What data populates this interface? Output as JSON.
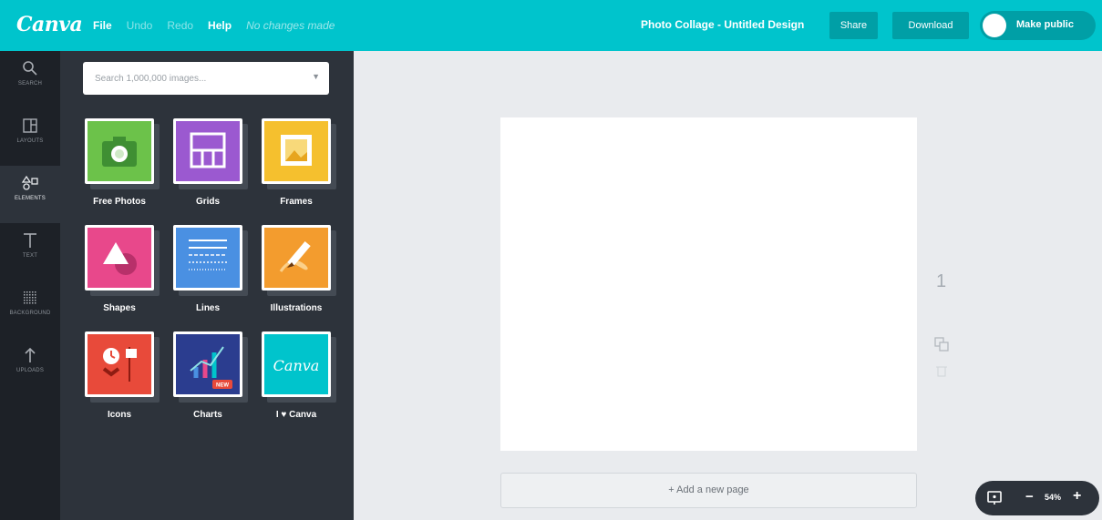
{
  "app": {
    "logo": "Canva"
  },
  "menu": {
    "file": "File",
    "undo": "Undo",
    "redo": "Redo",
    "help": "Help",
    "status": "No changes made"
  },
  "header": {
    "design_title": "Photo Collage - Untitled Design",
    "share": "Share",
    "download": "Download",
    "make_public": "Make public"
  },
  "rail": {
    "items": [
      {
        "label": "SEARCH",
        "icon": "search-icon"
      },
      {
        "label": "LAYOUTS",
        "icon": "layouts-icon"
      },
      {
        "label": "ELEMENTS",
        "icon": "elements-icon",
        "active": true
      },
      {
        "label": "TEXT",
        "icon": "text-icon"
      },
      {
        "label": "BACKGROUND",
        "icon": "background-icon"
      },
      {
        "label": "UPLOADS",
        "icon": "upload-icon"
      }
    ]
  },
  "search": {
    "placeholder": "Search 1,000,000 images..."
  },
  "elements": {
    "tiles": [
      {
        "label": "Free Photos",
        "color": "#6cc24a",
        "icon": "camera-icon"
      },
      {
        "label": "Grids",
        "color": "#9b59d0",
        "icon": "grid-icon"
      },
      {
        "label": "Frames",
        "color": "#f5c02e",
        "icon": "frame-icon"
      },
      {
        "label": "Shapes",
        "color": "#e8488b",
        "icon": "shapes-icon"
      },
      {
        "label": "Lines",
        "color": "#4a90e2",
        "icon": "lines-icon"
      },
      {
        "label": "Illustrations",
        "color": "#f39c2e",
        "icon": "pencil-icon"
      },
      {
        "label": "Icons",
        "color": "#e84a3a",
        "icon": "icons-icon"
      },
      {
        "label": "Charts",
        "color": "#2b3d8f",
        "icon": "chart-icon",
        "badge": "NEW"
      },
      {
        "label": "I ♥ Canva",
        "color": "#00c4cc",
        "icon": "canva-logo-icon",
        "card_text": "Canva"
      }
    ]
  },
  "canvas": {
    "page_number": "1",
    "add_page": "+ Add a new page"
  },
  "zoom": {
    "minus": "−",
    "value": "54%",
    "plus": "+"
  }
}
